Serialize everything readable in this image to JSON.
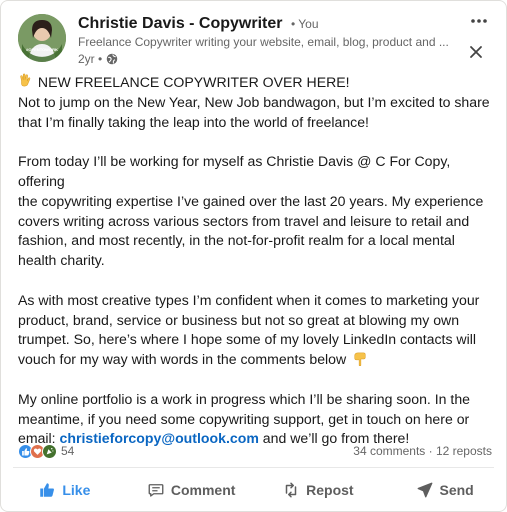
{
  "author": {
    "name": "Christie Davis - Copywriter",
    "badge": "• You",
    "headline": "Freelance Copywriter writing your website, email, blog, product and ...",
    "time": "2yr •",
    "avatar_caption": "#OPENTOWORK"
  },
  "post": {
    "title_line": "NEW FREELANCE COPYWRITER OVER HERE!",
    "p1a": "Not to jump on the New Year, New Job bandwagon, but I’m excited to share",
    "p1b": "that I’m finally taking the leap into the world of freelance!",
    "p2a": "From today I’ll be working for myself as Christie Davis @ C For Copy, offering",
    "p2b": "the copywriting expertise I’ve gained over the last 20 years. My experience",
    "p2c": "covers writing across various sectors from travel and leisure to retail and",
    "p2d": "fashion, and most recently, in the not-for-profit realm for a local mental",
    "p2e": "health charity.",
    "p3a": "As with most creative types I’m confident when it comes to marketing your",
    "p3b": "product, brand, service or business but not so great at blowing my own",
    "p3c": "trumpet. So, here’s where I hope some of my lovely LinkedIn contacts will",
    "p3d": "vouch for my way with words in the comments below",
    "p4a": "My online portfolio is a work in progress which I’ll be sharing soon. In the",
    "p4b": "meantime, if you need some copywriting support, get in touch on here or",
    "p4c_prefix": "email: ",
    "email": "christieforcopy@outlook.com",
    "p4c_suffix": " and we’ll go from there!"
  },
  "social": {
    "reaction_count": "54",
    "comments_reposts": "34 comments · 12 reposts"
  },
  "actions": {
    "like": "Like",
    "comment": "Comment",
    "repost": "Repost",
    "send": "Send"
  },
  "icons": {
    "more": "more-horizontal-icon",
    "close": "close-icon",
    "globe": "globe-icon",
    "wave": "waving-hand-emoji",
    "point_down": "pointing-down-emoji",
    "like": "thumbs-up-icon",
    "celebrate": "celebrate-icon",
    "love": "heart-icon",
    "support": "support-icon"
  },
  "colors": {
    "link": "#0a66c2",
    "like_blue": "#378fe9",
    "celebrate_green": "#44712e",
    "love_red": "#df704d",
    "text_primary": "#191919",
    "text_secondary": "#666666"
  }
}
